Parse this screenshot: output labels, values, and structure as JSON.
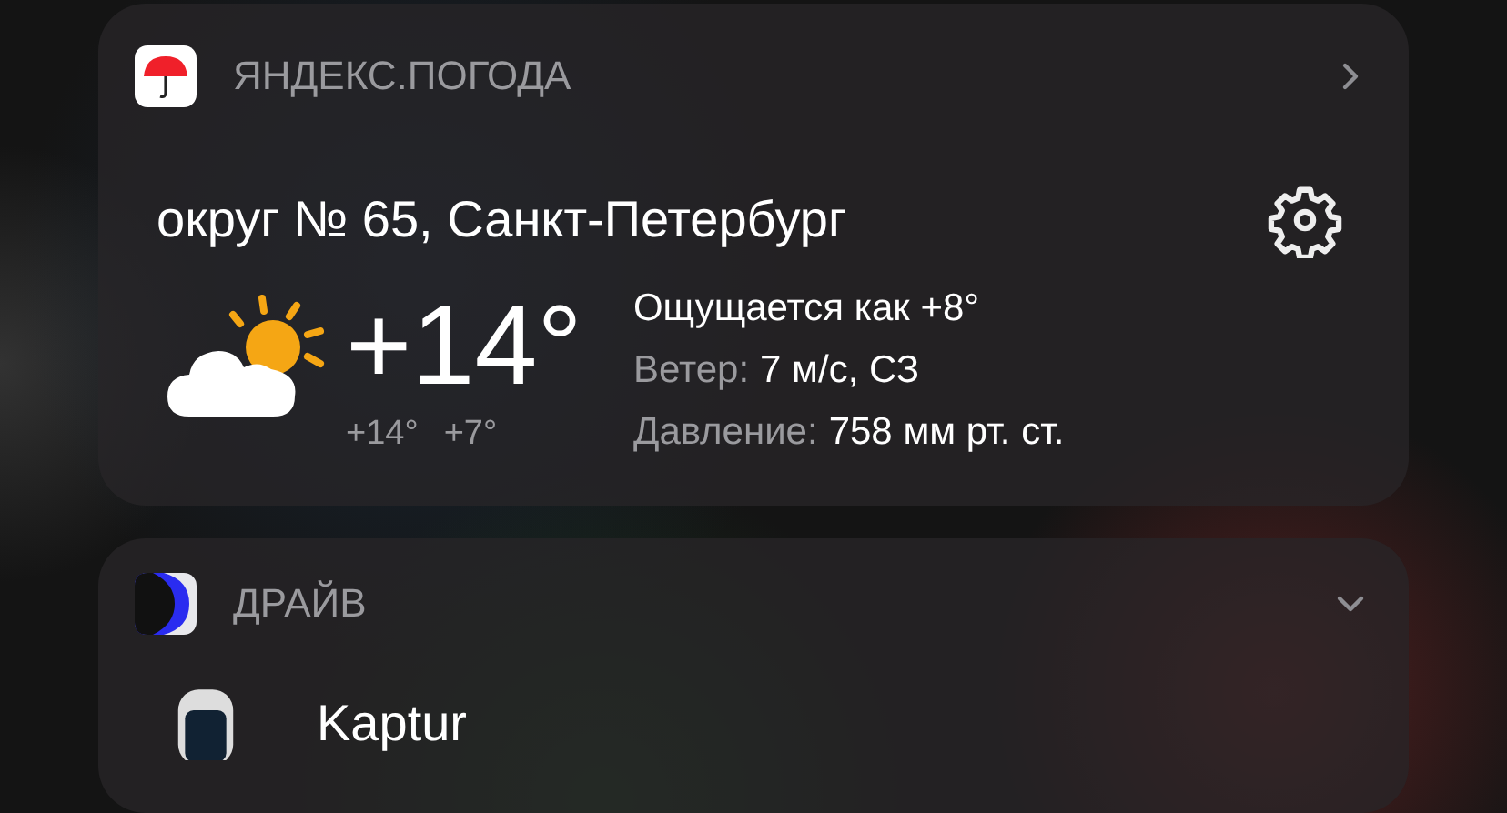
{
  "widgets": [
    {
      "kind": "weather",
      "app_name": "ЯНДЕКС.ПОГОДА",
      "expanded": false,
      "location": "округ № 65, Санкт-Петербург",
      "temperature": "+14°",
      "high": "+14°",
      "low": "+7°",
      "details": [
        {
          "label": "Ощущается как +8°"
        },
        {
          "label": "Ветер:",
          "value": "7 м/с, СЗ"
        },
        {
          "label": "Давление:",
          "value": "758 мм рт. ст."
        }
      ]
    },
    {
      "kind": "drive",
      "app_name": "ДРАЙВ",
      "expanded": true,
      "car": "Kaptur"
    }
  ]
}
